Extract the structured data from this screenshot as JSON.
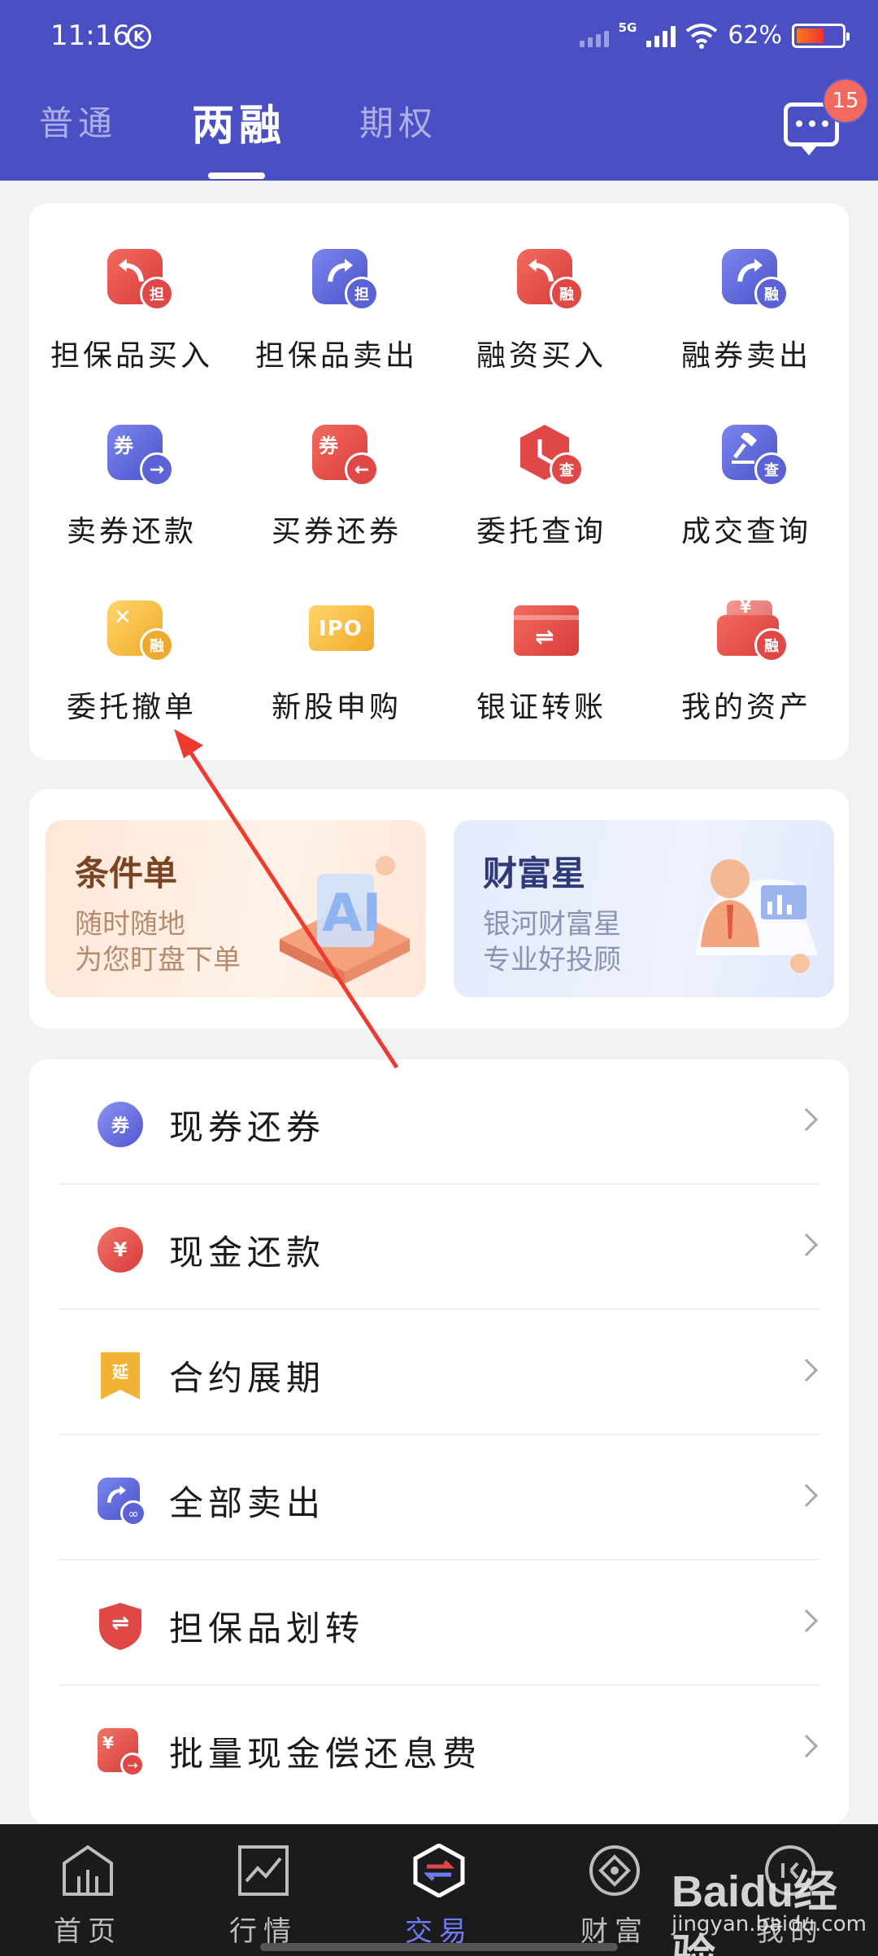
{
  "status_bar": {
    "time": "11:16",
    "time_badge": "K",
    "network": "5G",
    "battery_percent": "62%"
  },
  "header": {
    "tabs": [
      {
        "label": "普通",
        "active": false
      },
      {
        "label": "两融",
        "active": true
      },
      {
        "label": "期权",
        "active": false
      }
    ],
    "message_badge": "15"
  },
  "grid": {
    "items": [
      {
        "label": "担保品买入",
        "icon": "buy-arrow-icon",
        "sub": "担"
      },
      {
        "label": "担保品卖出",
        "icon": "sell-arrow-icon",
        "sub": "担"
      },
      {
        "label": "融资买入",
        "icon": "buy-arrow-icon",
        "sub": "融"
      },
      {
        "label": "融券卖出",
        "icon": "sell-arrow-icon",
        "sub": "融"
      },
      {
        "label": "卖券还款",
        "icon": "coupon-icon",
        "glyph": "券",
        "sub": "→"
      },
      {
        "label": "买券还券",
        "icon": "coupon-icon",
        "glyph": "券",
        "sub": "←"
      },
      {
        "label": "委托查询",
        "icon": "clock-icon",
        "sub": "查"
      },
      {
        "label": "成交查询",
        "icon": "hammer-icon",
        "sub": "查"
      },
      {
        "label": "委托撤单",
        "icon": "cancel-icon",
        "glyph": "✕",
        "sub": "融"
      },
      {
        "label": "新股申购",
        "icon": "ipo-icon",
        "glyph": "IPO"
      },
      {
        "label": "银证转账",
        "icon": "transfer-card-icon",
        "glyph": "⇌"
      },
      {
        "label": "我的资产",
        "icon": "wallet-icon",
        "glyph": "¥",
        "sub": "融"
      }
    ]
  },
  "banners": [
    {
      "title": "条件单",
      "line1": "随时随地",
      "line2": "为您盯盘下单",
      "art_text": "AI"
    },
    {
      "title": "财富星",
      "line1": "银河财富星",
      "line2": "专业好投顾"
    }
  ],
  "list": {
    "items": [
      {
        "label": "现券还券",
        "icon": "coupon-return-icon",
        "glyph": "券"
      },
      {
        "label": "现金还款",
        "icon": "cash-return-icon",
        "glyph": "¥"
      },
      {
        "label": "合约展期",
        "icon": "extend-icon",
        "glyph": "延"
      },
      {
        "label": "全部卖出",
        "icon": "sell-all-icon",
        "glyph": "∞"
      },
      {
        "label": "担保品划转",
        "icon": "shield-transfer-icon",
        "glyph": "⇌"
      },
      {
        "label": "批量现金偿还息费",
        "icon": "batch-repay-icon",
        "glyph": "¥"
      }
    ]
  },
  "bottom_nav": {
    "items": [
      {
        "label": "首页",
        "icon": "home-icon",
        "active": false
      },
      {
        "label": "行情",
        "icon": "chart-icon",
        "active": false
      },
      {
        "label": "交易",
        "icon": "trade-icon",
        "active": true
      },
      {
        "label": "财富",
        "icon": "wealth-icon",
        "active": false
      },
      {
        "label": "我的",
        "icon": "profile-icon",
        "active": false
      }
    ]
  },
  "watermark": {
    "logo": "Baidu经验",
    "site": "jingyan.baidu.com"
  },
  "colors": {
    "header_bg": "#4a4fc4",
    "accent_red": "#e04444",
    "accent_blue": "#5a62d6",
    "accent_gold": "#f2b233",
    "nav_active": "#6f7af5",
    "annotation_arrow": "#ee3a2f"
  }
}
